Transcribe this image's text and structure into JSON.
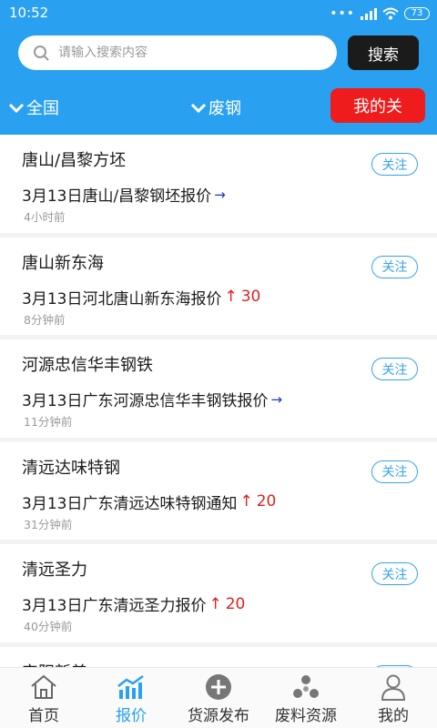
{
  "status_bar": {
    "time": "10:52",
    "battery": "73"
  },
  "search": {
    "placeholder": "请输入搜索内容",
    "value": "",
    "button_label": "搜索"
  },
  "filters": {
    "region": "全国",
    "category": "废钢",
    "follow_tab": "我的关"
  },
  "items": [
    {
      "title": "唐山/昌黎方坯",
      "follow_label": "关注",
      "description": "3月13日唐山/昌黎钢坯报价",
      "trend": "flat",
      "trend_symbol": "→",
      "change": "",
      "time": "4小时前"
    },
    {
      "title": "唐山新东海",
      "follow_label": "关注",
      "description": "3月13日河北唐山新东海报价",
      "trend": "up",
      "trend_symbol": "↑",
      "change": "30",
      "time": "8分钟前"
    },
    {
      "title": "河源忠信华丰钢铁",
      "follow_label": "关注",
      "description": "3月13日广东河源忠信华丰钢铁报价",
      "trend": "flat",
      "trend_symbol": "→",
      "change": "",
      "time": "11分钟前"
    },
    {
      "title": "清远达味特钢",
      "follow_label": "关注",
      "description": "3月13日广东清远达味特钢通知",
      "trend": "up",
      "trend_symbol": "↑",
      "change": "20",
      "time": "31分钟前"
    },
    {
      "title": "清远圣力",
      "follow_label": "关注",
      "description": "3月13日广东清远圣力报价",
      "trend": "up",
      "trend_symbol": "↑",
      "change": "20",
      "time": "40分钟前"
    },
    {
      "title": "安阳新普",
      "follow_label": "关注",
      "description": "",
      "trend": "",
      "trend_symbol": "",
      "change": "",
      "time": ""
    }
  ],
  "nav": [
    {
      "label": "首页",
      "icon": "home-icon",
      "active": false
    },
    {
      "label": "报价",
      "icon": "chart-icon",
      "active": true
    },
    {
      "label": "货源发布",
      "icon": "plus-circle-icon",
      "active": false
    },
    {
      "label": "废料资源",
      "icon": "recycle-icon",
      "active": false
    },
    {
      "label": "我的",
      "icon": "user-icon",
      "active": false
    }
  ],
  "colors": {
    "primary": "#2aa1f0",
    "follow_tab": "#ee1c1c",
    "search_button": "#1b1b1b",
    "trend_up": "#e02020",
    "trend_flat": "#1836c8"
  }
}
